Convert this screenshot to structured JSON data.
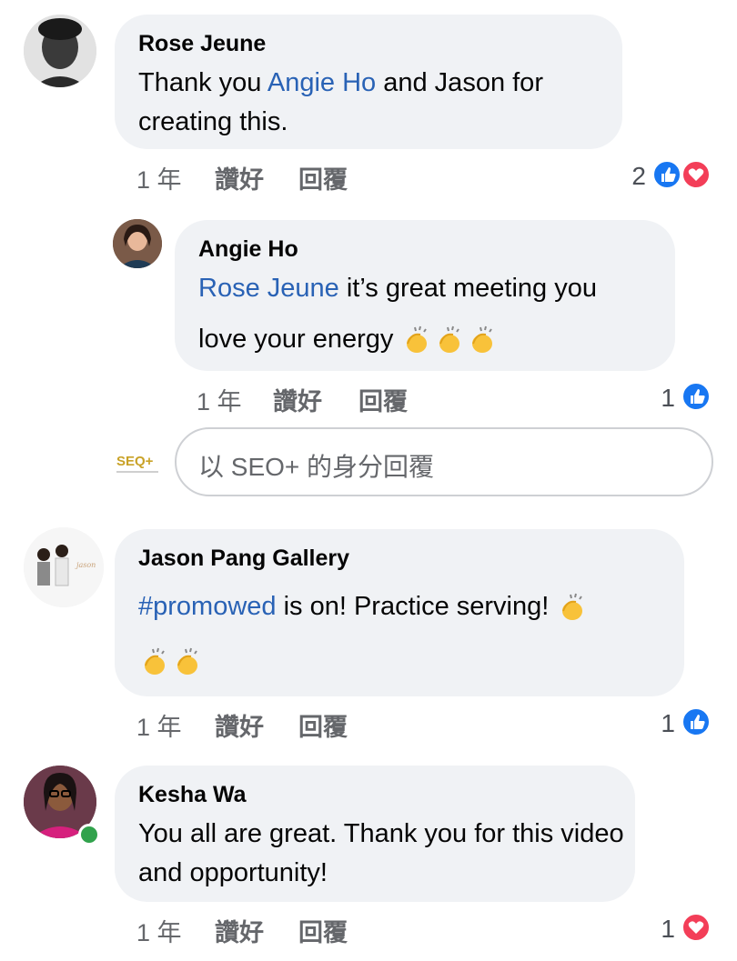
{
  "comments": [
    {
      "author": "Rose Jeune",
      "mention": "Angie Ho",
      "text_before": "Thank you ",
      "text_after": " and Jason for creating this.",
      "time": "1 年",
      "like_label": "讚好",
      "reply_label": "回覆",
      "reaction_count": "2"
    },
    {
      "author": "Angie Ho",
      "mention": "Rose Jeune",
      "text_line1": " it’s great meeting you",
      "text_line2": "love your energy",
      "time": "1 年",
      "like_label": "讚好",
      "reply_label": "回覆",
      "reaction_count": "1"
    },
    {
      "author": "Jason Pang Gallery",
      "hashtag": "#promowed",
      "text_after": " is on! Practice serving!",
      "time": "1 年",
      "like_label": "讚好",
      "reply_label": "回覆",
      "reaction_count": "1"
    },
    {
      "author": "Kesha Wa",
      "text": "You all are great. Thank you for this video and opportunity!",
      "time": "1 年",
      "like_label": "讚好",
      "reply_label": "回覆",
      "reaction_count": "1"
    }
  ],
  "reply_box": {
    "placeholder": "以 SEO+ 的身分回覆",
    "page_logo_text": "SEQ+"
  },
  "colors": {
    "bubble": "#f0f2f5",
    "mention": "#2962b5",
    "like": "#1877f2",
    "love": "#f33e58",
    "online": "#31a24c"
  }
}
